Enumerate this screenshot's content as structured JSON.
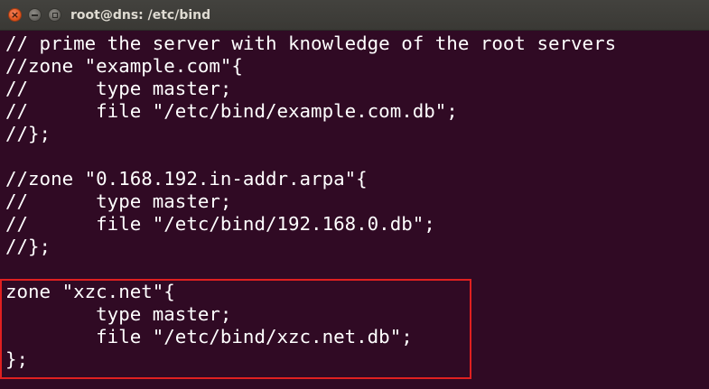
{
  "window": {
    "title": "root@dns: /etc/bind",
    "close_glyph": "×"
  },
  "terminal": {
    "lines": [
      "// prime the server with knowledge of the root servers",
      "//zone \"example.com\"{",
      "//      type master;",
      "//      file \"/etc/bind/example.com.db\";",
      "//};",
      "",
      "//zone \"0.168.192.in-addr.arpa\"{",
      "//      type master;",
      "//      file \"/etc/bind/192.168.0.db\";",
      "//};",
      "",
      "zone \"xzc.net\"{",
      "        type master;",
      "        file \"/etc/bind/xzc.net.db\";",
      "};"
    ],
    "highlighted_lines": [
      11,
      12,
      13,
      14
    ]
  },
  "colors": {
    "background": "#300a24",
    "text": "#ffffff",
    "highlight_border": "#e02020",
    "close_button": "#e0561f"
  }
}
